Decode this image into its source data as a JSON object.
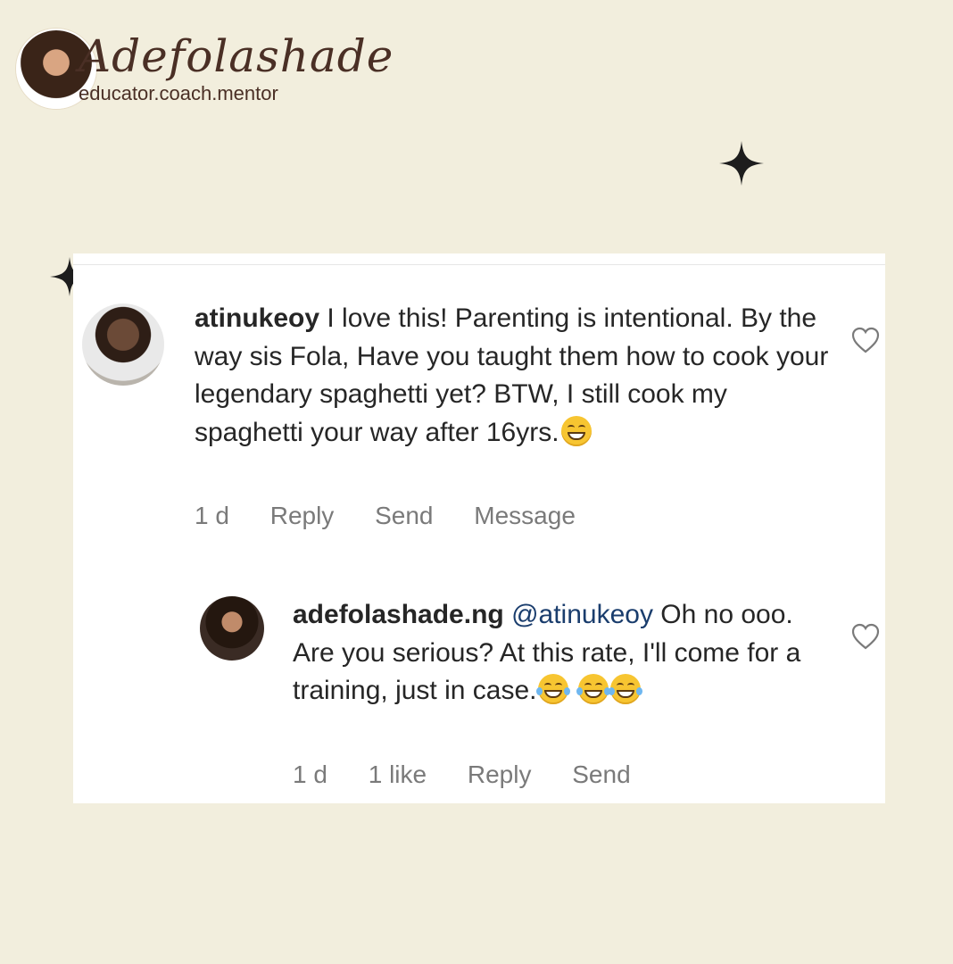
{
  "brand": {
    "name": "Adefolashade",
    "tagline": "educator.coach.mentor"
  },
  "icons": {
    "sparkle": "sparkle-icon",
    "heart": "heart-outline-icon",
    "emoji_grin": "grinning-face-icon",
    "emoji_tears": "tears-of-joy-icon"
  },
  "colors": {
    "background": "#f2eedd",
    "card": "#ffffff",
    "text": "#262626",
    "meta": "#7a7a7a",
    "mention": "#1a3d6d",
    "brand": "#4a2f25"
  },
  "comments": [
    {
      "username": "atinukeoy",
      "text": "I love this! Parenting is intentional. By the way sis Fola, Have you taught them how to cook your legendary spaghetti yet? BTW, I still cook my spaghetti your way after 16yrs.",
      "time": "1 d",
      "actions": [
        "Reply",
        "Send",
        "Message"
      ]
    },
    {
      "username": "adefolashade.ng",
      "mention": "@atinukeoy",
      "text": "Oh no ooo. Are you serious? At this rate, I'll come for a training, just in case.",
      "time": "1 d",
      "likes": "1 like",
      "actions": [
        "Reply",
        "Send"
      ]
    }
  ]
}
